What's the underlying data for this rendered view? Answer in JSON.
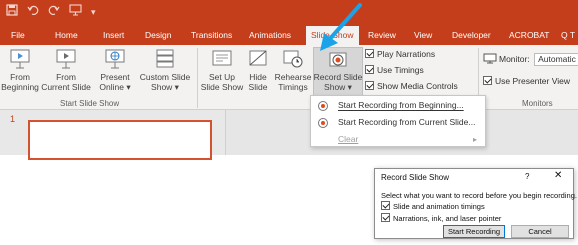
{
  "colors": {
    "accent": "#c43e1c",
    "ribbon": "#f3f2f1",
    "pointer": "#1aa3e8"
  },
  "qat": {
    "save_icon": "save-icon",
    "undo_icon": "undo-icon",
    "redo_icon": "redo-icon",
    "present_icon": "present-from-start-icon",
    "customize_label": "▾"
  },
  "tabs": [
    "File",
    "Home",
    "Insert",
    "Design",
    "Transitions",
    "Animations",
    "Slide Show",
    "Review",
    "View",
    "Developer",
    "ACROBAT",
    "Q T"
  ],
  "active_tab": "Slide Show",
  "ribbon": {
    "start_group": {
      "label": "Start Slide Show",
      "from_beginning": [
        "From",
        "Beginning"
      ],
      "from_current": [
        "From",
        "Current Slide"
      ],
      "present_online": [
        "Present",
        "Online ▾"
      ],
      "custom_show": [
        "Custom Slide",
        "Show ▾"
      ]
    },
    "setup_group": {
      "set_up": [
        "Set Up",
        "Slide Show"
      ],
      "hide": [
        "Hide",
        "Slide"
      ],
      "rehearse": [
        "Rehearse",
        "Timings"
      ],
      "record": [
        "Record Slide",
        "Show ▾"
      ]
    },
    "checks": {
      "play_narrations": "Play Narrations",
      "use_timings": "Use Timings",
      "show_media_controls": "Show Media Controls"
    },
    "monitors": {
      "label": "Monitors",
      "monitor_label": "Monitor:",
      "monitor_value": "Automatic",
      "presenter_view": "Use Presenter View"
    }
  },
  "menu": {
    "items": [
      {
        "label": "Start Recording from Beginning...",
        "disabled": false
      },
      {
        "label": "Start Recording from Current Slide...",
        "disabled": false
      },
      {
        "label": "Clear",
        "disabled": true
      }
    ]
  },
  "workspace": {
    "slide_number": "1"
  },
  "dialog": {
    "title": "Record Slide Show",
    "help": "?",
    "close": "✕",
    "prompt": "Select what you want to record before you begin recording.",
    "options": [
      {
        "label": "Slide and animation timings",
        "checked": true
      },
      {
        "label": "Narrations, ink, and laser pointer",
        "checked": true
      }
    ],
    "start_button": "Start Recording",
    "cancel_button": "Cancel"
  }
}
